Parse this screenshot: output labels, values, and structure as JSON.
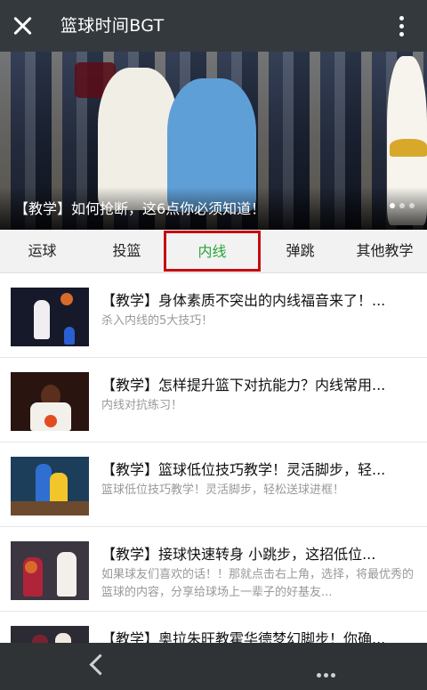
{
  "header": {
    "title": "篮球时间BGT"
  },
  "hero": {
    "caption": "【教学】如何抢断，这6点你必须知道！",
    "slides": 3,
    "active_slide": 1
  },
  "tabs": [
    {
      "label": "运球",
      "active": false
    },
    {
      "label": "投篮",
      "active": false
    },
    {
      "label": "内线",
      "active": true
    },
    {
      "label": "弹跳",
      "active": false
    },
    {
      "label": "其他教学",
      "active": false
    }
  ],
  "articles": [
    {
      "title": "【教学】身体素质不突出的内线福音来了！...",
      "desc": "杀入内线的5大技巧！"
    },
    {
      "title": "【教学】怎样提升篮下对抗能力？内线常用...",
      "desc": "内线对抗练习！"
    },
    {
      "title": "【教学】篮球低位技巧教学！灵活脚步，轻...",
      "desc": "篮球低位技巧教学！灵活脚步，轻松送球进框！"
    },
    {
      "title": "【教学】接球快速转身 小跳步，这招低位...",
      "desc": "如果球友们喜欢的话！！那就点击右上角，选择，将最优秀的篮球的内容，分享给球场上一辈子的好基友..."
    },
    {
      "title": "【教学】奥拉朱旺教霍华德梦幻脚步！你确...",
      "desc": ""
    }
  ],
  "colors": {
    "topbar": "#34393d",
    "active_tab_text": "#27a537",
    "active_tab_border": "#c40e12",
    "navbar": "#2f3336"
  },
  "icons": {
    "close": "close-icon",
    "more": "more-vertical-icon",
    "back": "chevron-left-icon",
    "menu": "more-horizontal-icon"
  }
}
